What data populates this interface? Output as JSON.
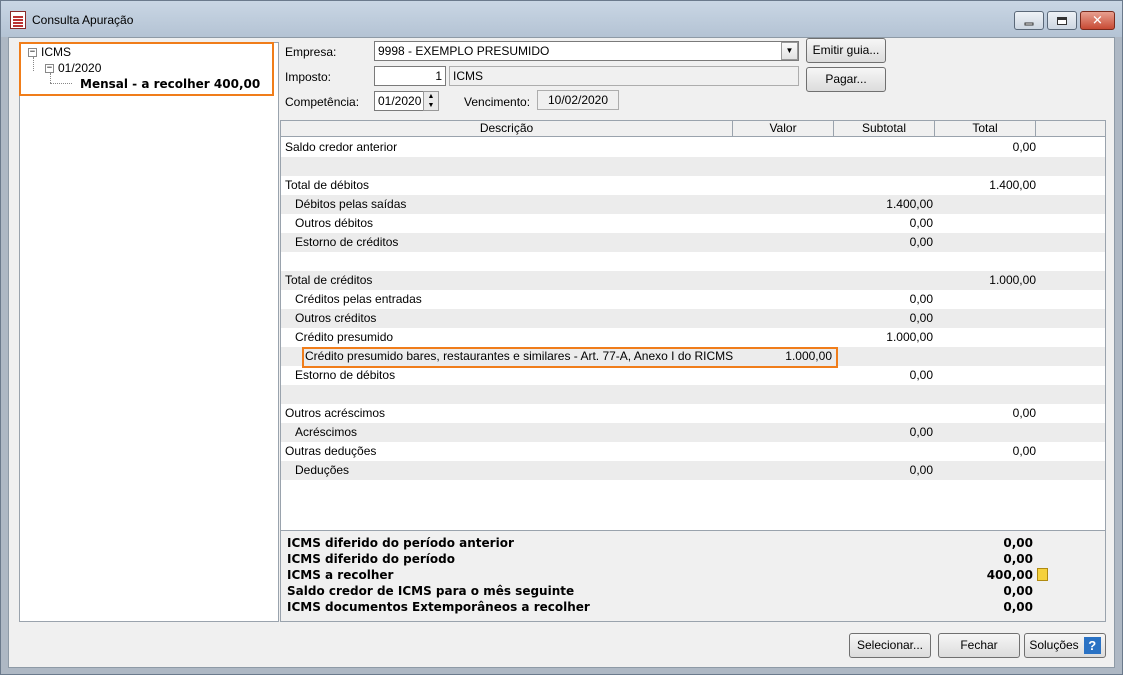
{
  "window": {
    "title": "Consulta Apuração"
  },
  "tree": {
    "root": "ICMS",
    "period": "01/2020",
    "leaf": "Mensal - a recolher 400,00"
  },
  "form": {
    "empresa_label": "Empresa:",
    "empresa_value": "9998 - EXEMPLO PRESUMIDO",
    "imposto_label": "Imposto:",
    "imposto_code": "1",
    "imposto_name": "ICMS",
    "competencia_label": "Competência:",
    "competencia_value": "01/2020",
    "vencimento_label": "Vencimento:",
    "vencimento_value": "10/02/2020",
    "emitir_guia_label": "Emitir guia...",
    "pagar_label": "Pagar..."
  },
  "grid": {
    "headers": [
      "Descrição",
      "Valor",
      "Subtotal",
      "Total"
    ],
    "rows": [
      {
        "desc": "Saldo credor anterior",
        "valor": "",
        "subtotal": "",
        "total": "0,00"
      },
      {
        "desc": "",
        "valor": "",
        "subtotal": "",
        "total": ""
      },
      {
        "desc": "Total de débitos",
        "valor": "",
        "subtotal": "",
        "total": "1.400,00"
      },
      {
        "desc": "Débitos pelas saídas",
        "valor": "",
        "subtotal": "1.400,00",
        "total": ""
      },
      {
        "desc": "Outros débitos",
        "valor": "",
        "subtotal": "0,00",
        "total": ""
      },
      {
        "desc": "Estorno de créditos",
        "valor": "",
        "subtotal": "0,00",
        "total": ""
      },
      {
        "desc": "",
        "valor": "",
        "subtotal": "",
        "total": ""
      },
      {
        "desc": "Total de créditos",
        "valor": "",
        "subtotal": "",
        "total": "1.000,00"
      },
      {
        "desc": "Créditos pelas entradas",
        "valor": "",
        "subtotal": "0,00",
        "total": ""
      },
      {
        "desc": "Outros créditos",
        "valor": "",
        "subtotal": "0,00",
        "total": ""
      },
      {
        "desc": "Crédito presumido",
        "valor": "",
        "subtotal": "1.000,00",
        "total": ""
      },
      {
        "desc": "Crédito presumido bares, restaurantes e similares - Art. 77-A, Anexo I do RICMS",
        "valor": "1.000,00",
        "subtotal": "",
        "total": ""
      },
      {
        "desc": "Estorno de débitos",
        "valor": "",
        "subtotal": "0,00",
        "total": ""
      },
      {
        "desc": "",
        "valor": "",
        "subtotal": "",
        "total": ""
      },
      {
        "desc": "Outros acréscimos",
        "valor": "",
        "subtotal": "",
        "total": "0,00"
      },
      {
        "desc": "Acréscimos",
        "valor": "",
        "subtotal": "0,00",
        "total": ""
      },
      {
        "desc": "Outras deduções",
        "valor": "",
        "subtotal": "",
        "total": "0,00"
      },
      {
        "desc": "Deduções",
        "valor": "",
        "subtotal": "0,00",
        "total": ""
      }
    ]
  },
  "summary": [
    {
      "label": "ICMS diferido do período anterior",
      "value": "0,00"
    },
    {
      "label": "ICMS diferido do período",
      "value": "0,00"
    },
    {
      "label": "ICMS a recolher",
      "value": "400,00"
    },
    {
      "label": "Saldo credor de ICMS para o mês seguinte",
      "value": "0,00"
    },
    {
      "label": "ICMS documentos Extemporâneos a recolher",
      "value": "0,00"
    }
  ],
  "footer": {
    "selecionar_label": "Selecionar...",
    "fechar_label": "Fechar",
    "solucoes_label": "Soluções"
  },
  "colors": {
    "highlight": "#f07d1a",
    "help_icon": "#2a72c4"
  }
}
